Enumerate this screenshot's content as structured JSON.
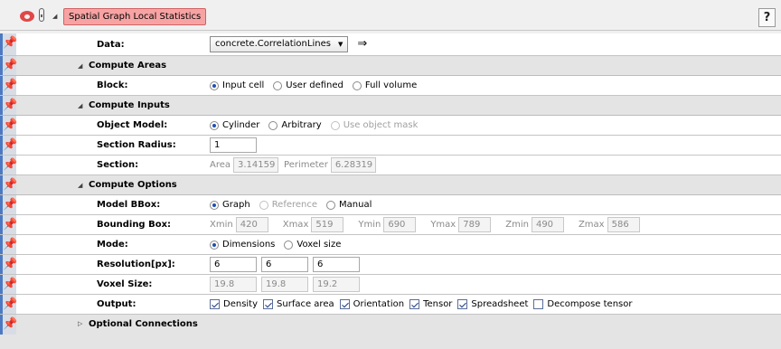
{
  "module": {
    "name": "Spatial Graph Local Statistics",
    "help_label": "?"
  },
  "rows": {
    "data": {
      "label": "Data:",
      "value": "concrete.CorrelationLines"
    },
    "compute_areas": {
      "label": "Compute Areas"
    },
    "block": {
      "label": "Block:",
      "options": [
        "Input cell",
        "User defined",
        "Full volume"
      ],
      "selected": "Input cell"
    },
    "compute_inputs": {
      "label": "Compute Inputs"
    },
    "object_model": {
      "label": "Object Model:",
      "options": [
        "Cylinder",
        "Arbitrary",
        "Use object mask"
      ],
      "selected": "Cylinder"
    },
    "section_radius": {
      "label": "Section Radius:",
      "value": "1"
    },
    "section": {
      "label": "Section:",
      "area_label": "Area",
      "area_value": "3.14159",
      "perimeter_label": "Perimeter",
      "perimeter_value": "6.28319"
    },
    "compute_options": {
      "label": "Compute Options"
    },
    "model_bbox": {
      "label": "Model BBox:",
      "options": [
        "Graph",
        "Reference",
        "Manual"
      ],
      "selected": "Graph"
    },
    "bounding_box": {
      "label": "Bounding Box:",
      "xmin_label": "Xmin",
      "xmin": "420",
      "xmax_label": "Xmax",
      "xmax": "519",
      "ymin_label": "Ymin",
      "ymin": "690",
      "ymax_label": "Ymax",
      "ymax": "789",
      "zmin_label": "Zmin",
      "zmin": "490",
      "zmax_label": "Zmax",
      "zmax": "586"
    },
    "mode": {
      "label": "Mode:",
      "options": [
        "Dimensions",
        "Voxel size"
      ],
      "selected": "Dimensions"
    },
    "resolution": {
      "label": "Resolution[px]:",
      "values": [
        "6",
        "6",
        "6"
      ]
    },
    "voxel_size": {
      "label": "Voxel Size:",
      "values": [
        "19.8",
        "19.8",
        "19.2"
      ]
    },
    "output": {
      "label": "Output:",
      "items": [
        "Density",
        "Surface area",
        "Orientation",
        "Tensor",
        "Spreadsheet",
        "Decompose tensor"
      ],
      "checked": [
        true,
        true,
        true,
        true,
        true,
        false
      ]
    },
    "optional_connections": {
      "label": "Optional Connections"
    }
  }
}
